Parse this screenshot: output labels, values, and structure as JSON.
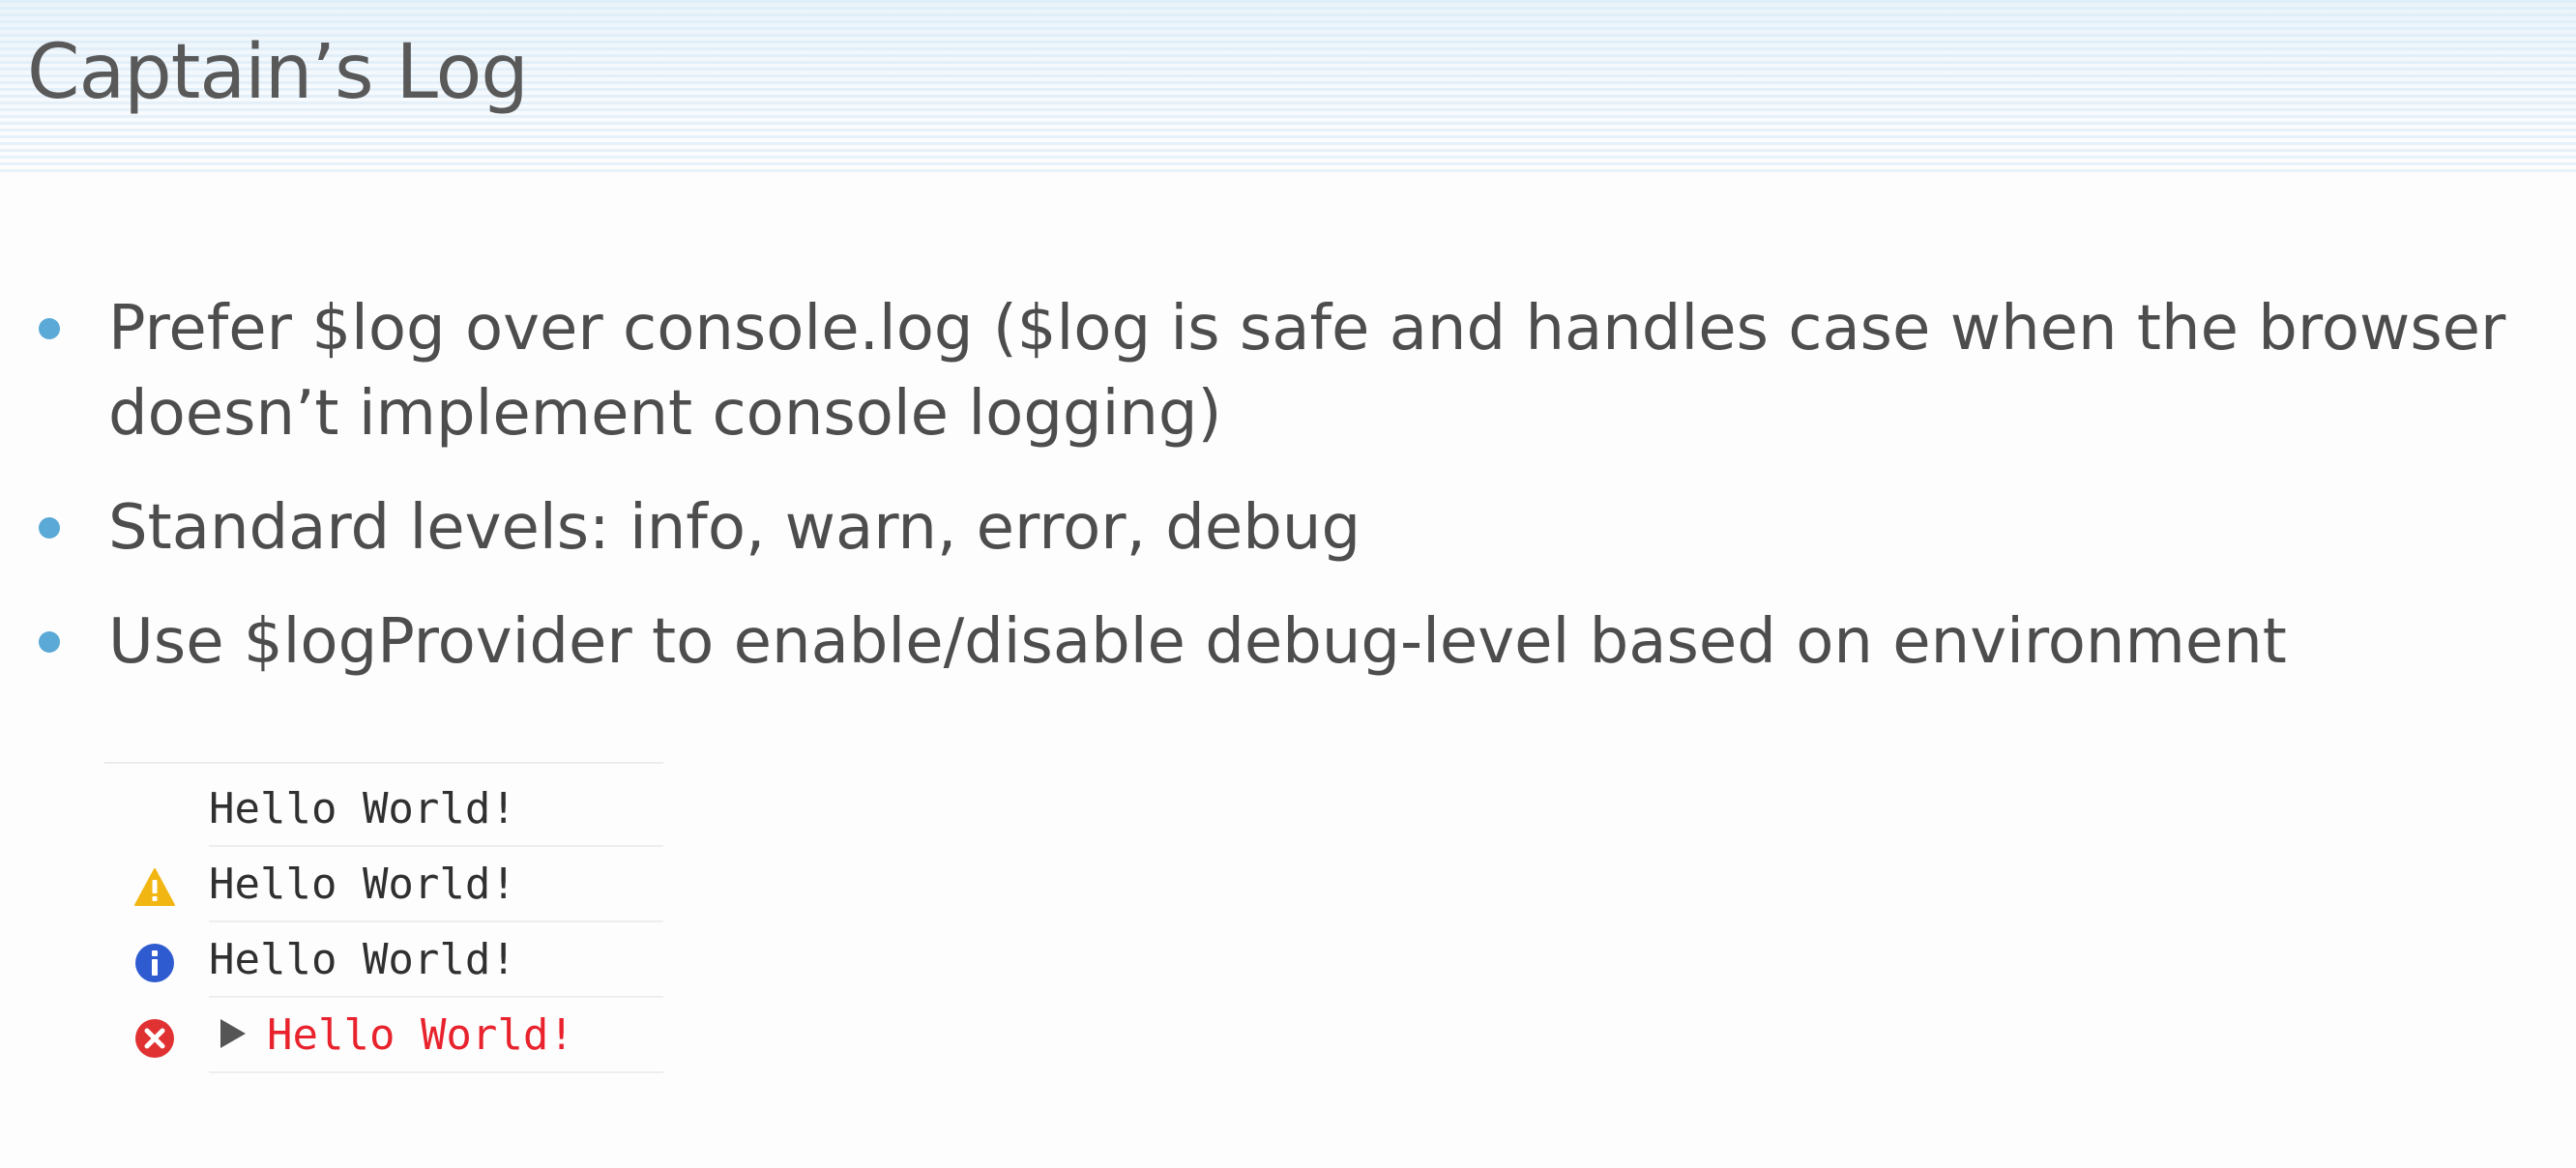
{
  "slide": {
    "title": "Captain’s Log",
    "bullets": [
      "Prefer $log over console.log ($log is safe and handles case when the browser doesn’t implement console logging)",
      "Standard levels: info, warn, error, debug",
      "Use $logProvider to enable/disable debug-level based on environment"
    ]
  },
  "console": {
    "rows": [
      {
        "level": "log",
        "icon": "none",
        "text": "Hello World!"
      },
      {
        "level": "warn",
        "icon": "warning-icon",
        "text": "Hello World!"
      },
      {
        "level": "info",
        "icon": "info-icon",
        "text": "Hello World!"
      },
      {
        "level": "error",
        "icon": "error-icon",
        "text": "Hello World!"
      }
    ]
  },
  "colors": {
    "bullet": "#5aa9d6",
    "warning": "#f2b613",
    "info": "#2f5bd1",
    "error": "#e03232",
    "error_text": "#e8232d"
  }
}
